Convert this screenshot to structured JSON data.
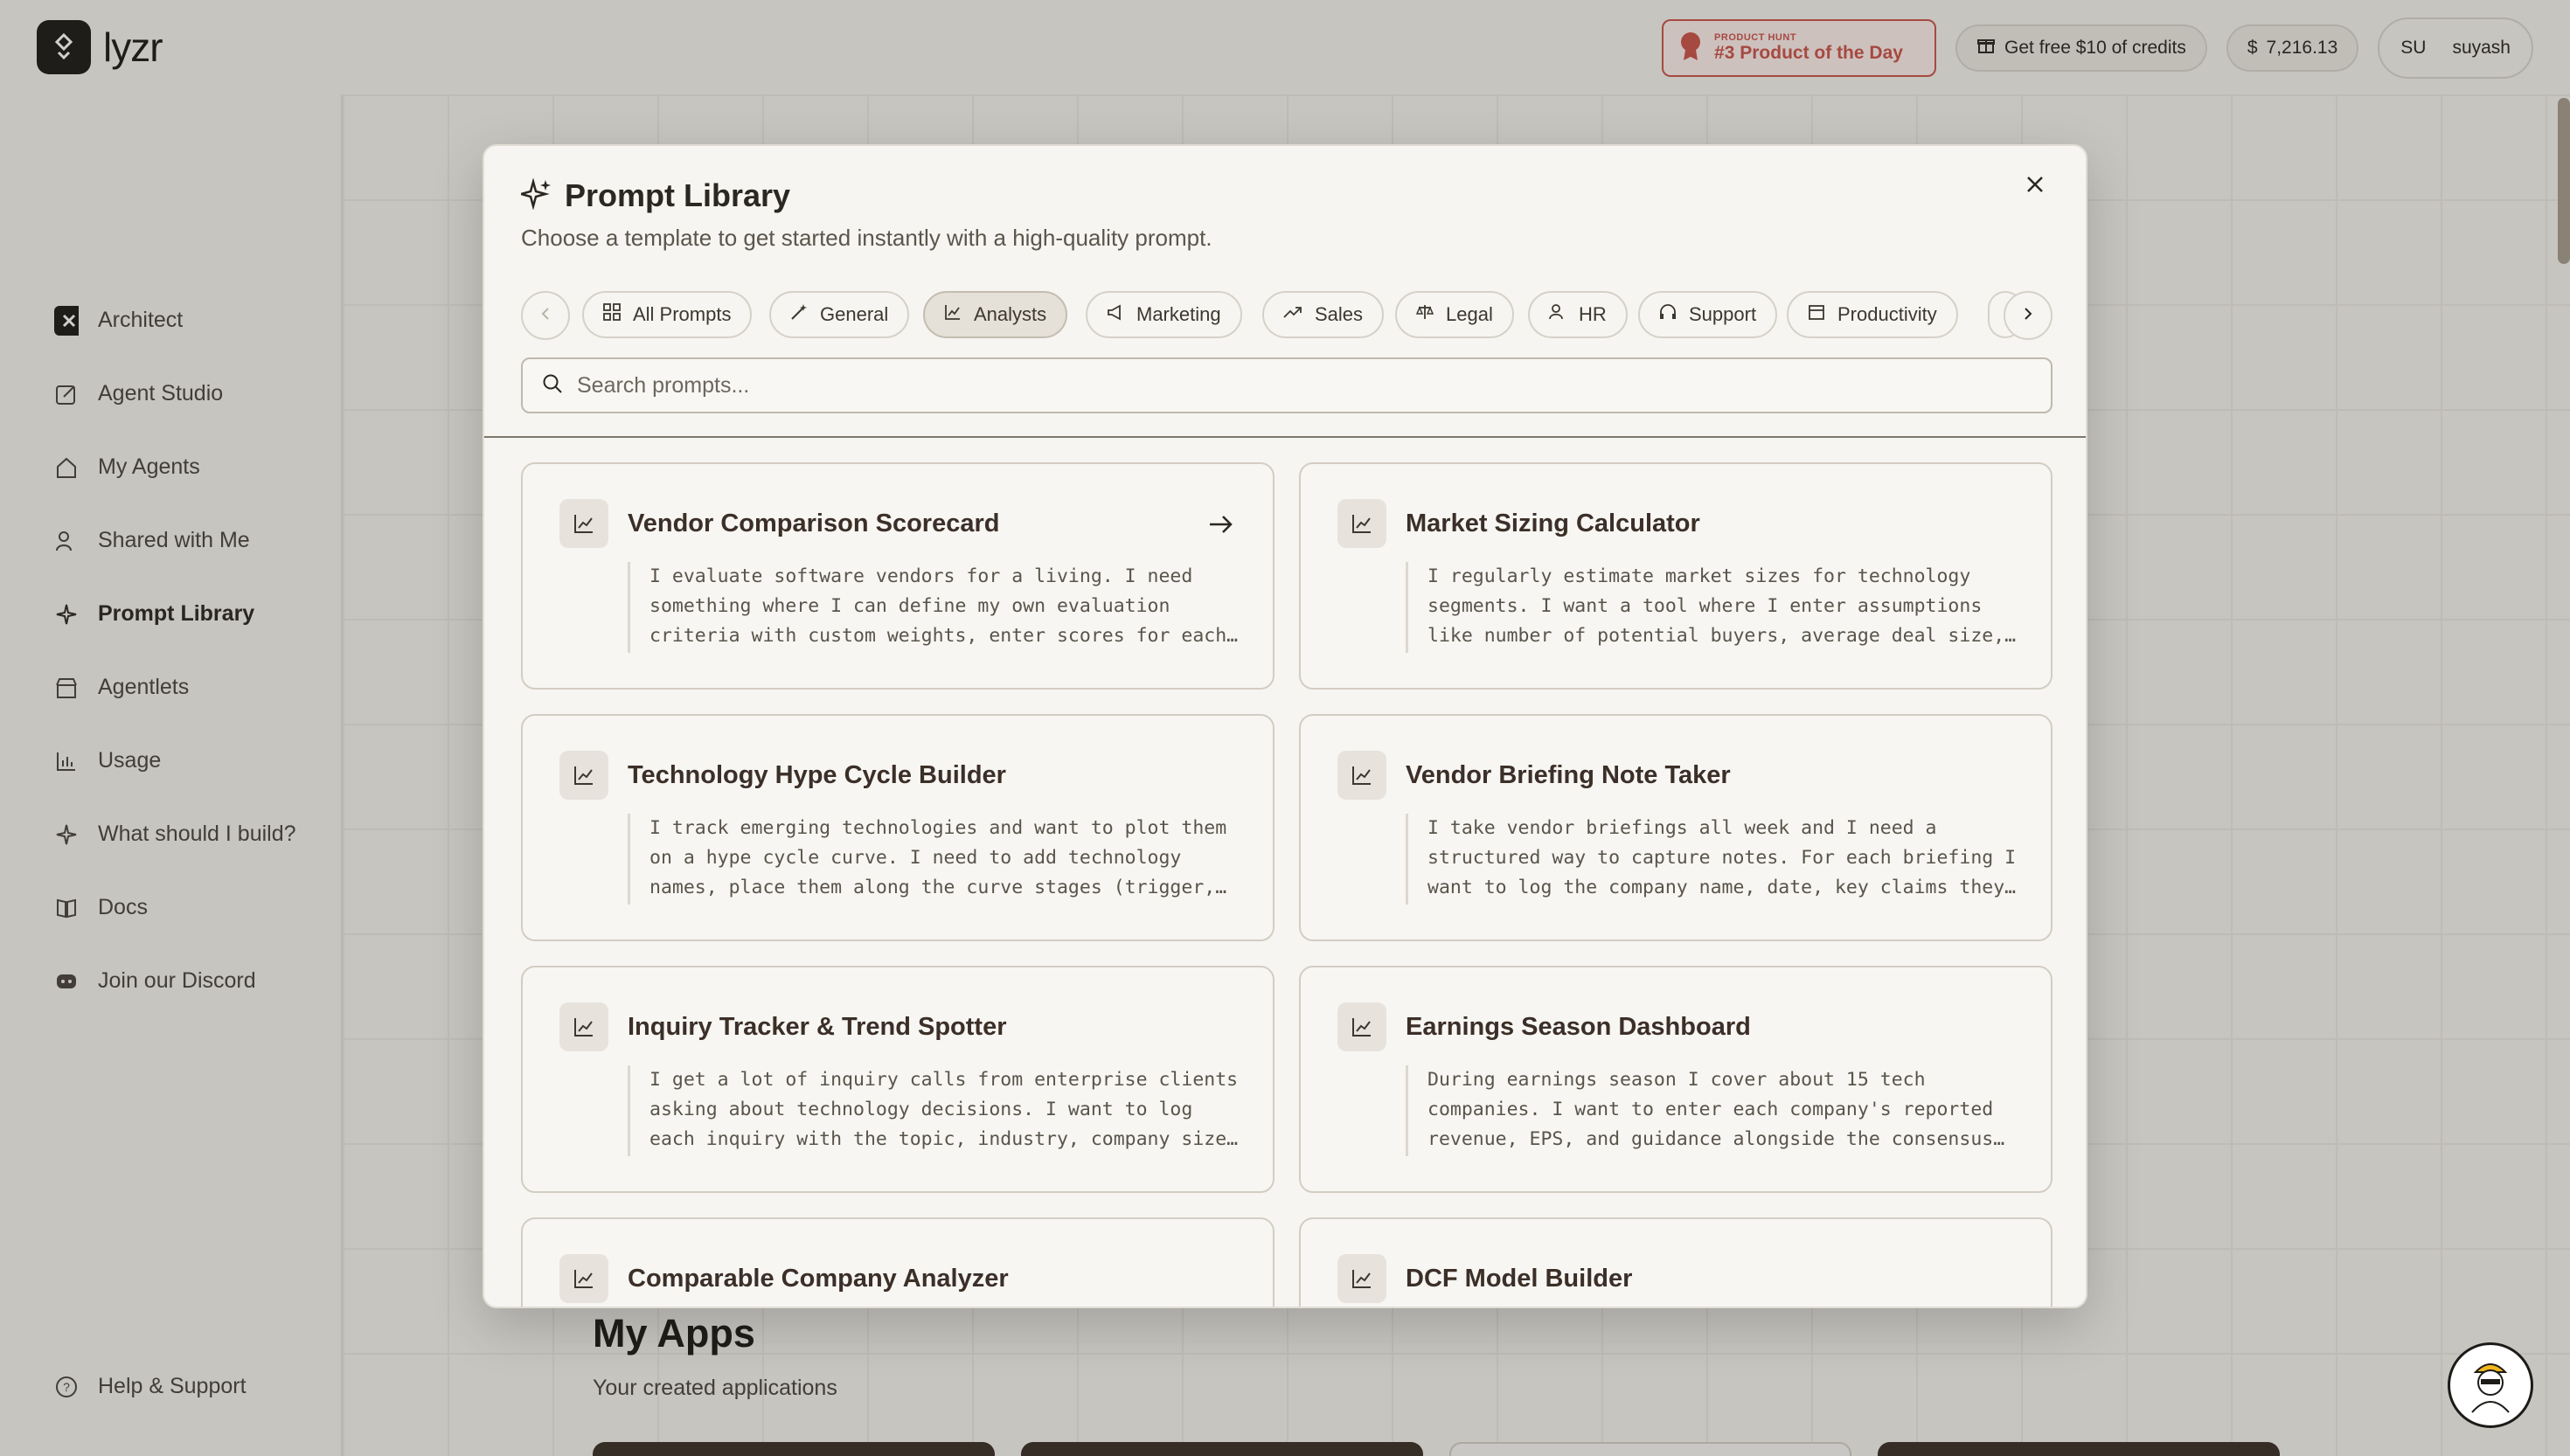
{
  "app": {
    "brand": "lyzr"
  },
  "topbar": {
    "ph_small": "PRODUCT HUNT",
    "ph_big": "#3 Product of the Day",
    "credits_label": "Get free $10 of credits",
    "balance": "7,216.13",
    "user_initials": "SU",
    "user_name": "suyash"
  },
  "sidebar": {
    "items": [
      {
        "label": "Architect",
        "icon": "architect-icon"
      },
      {
        "label": "Agent Studio",
        "icon": "edit-icon"
      },
      {
        "label": "My Agents",
        "icon": "home-icon"
      },
      {
        "label": "Shared with Me",
        "icon": "users-icon"
      },
      {
        "label": "Prompt Library",
        "icon": "sparkle-icon"
      },
      {
        "label": "Agentlets",
        "icon": "store-icon"
      },
      {
        "label": "Usage",
        "icon": "bar-chart-icon"
      },
      {
        "label": "What should I build?",
        "icon": "sparkle-icon"
      },
      {
        "label": "Docs",
        "icon": "book-icon"
      },
      {
        "label": "Join our Discord",
        "icon": "discord-icon"
      }
    ],
    "help": "Help & Support"
  },
  "main": {
    "apps_title": "My Apps",
    "apps_subtitle": "Your created applications"
  },
  "modal": {
    "title": "Prompt Library",
    "subtitle": "Choose a template to get started instantly with a high-quality prompt.",
    "tabs": [
      {
        "label": "All Prompts",
        "icon": "grid-icon"
      },
      {
        "label": "General",
        "icon": "wand-icon"
      },
      {
        "label": "Analysts",
        "icon": "line-chart-icon",
        "active": true
      },
      {
        "label": "Marketing",
        "icon": "megaphone-icon"
      },
      {
        "label": "Sales",
        "icon": "trending-up-icon"
      },
      {
        "label": "Legal",
        "icon": "scale-icon"
      },
      {
        "label": "HR",
        "icon": "users-icon"
      },
      {
        "label": "Support",
        "icon": "headphones-icon"
      },
      {
        "label": "Productivity",
        "icon": "calendar-icon"
      }
    ],
    "search_placeholder": "Search prompts...",
    "cards": [
      {
        "title": "Vendor Comparison Scorecard",
        "desc": "I evaluate software vendors for a living. I need something where I can define my own evaluation criteria with custom weights, enter scores for each vendor"
      },
      {
        "title": "Market Sizing Calculator",
        "desc": "I regularly estimate market sizes for technology segments. I want a tool where I enter assumptions like number of potential buyers, average deal size, adoption rates"
      },
      {
        "title": "Technology Hype Cycle Builder",
        "desc": "I track emerging technologies and want to plot them on a hype cycle curve. I need to add technology names, place them along the curve stages (trigger, peak"
      },
      {
        "title": "Vendor Briefing Note Taker",
        "desc": "I take vendor briefings all week and I need a structured way to capture notes. For each briefing I want to log the company name, date, key claims they make"
      },
      {
        "title": "Inquiry Tracker & Trend Spotter",
        "desc": "I get a lot of inquiry calls from enterprise clients asking about technology decisions. I want to log each inquiry with the topic, industry, company size, and outcome"
      },
      {
        "title": "Earnings Season Dashboard",
        "desc": "During earnings season I cover about 15 tech companies. I want to enter each company's reported revenue, EPS, and guidance alongside the consensus estimates"
      },
      {
        "title": "Comparable Company Analyzer",
        "desc": ""
      },
      {
        "title": "DCF Model Builder",
        "desc": ""
      }
    ]
  }
}
